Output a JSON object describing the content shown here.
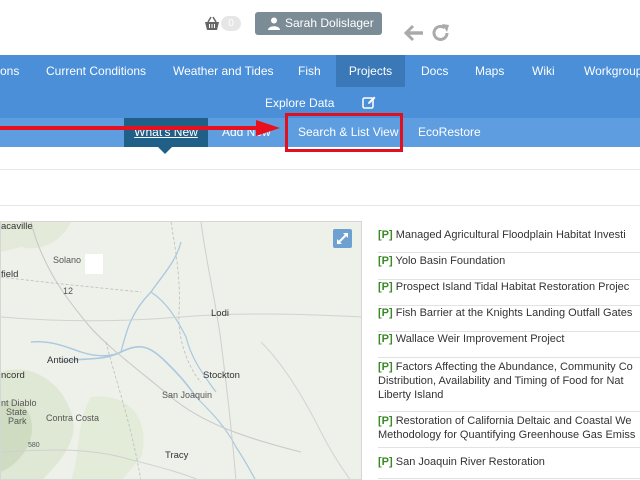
{
  "topbar": {
    "cart_count": "0",
    "user_name": "Sarah Dolislager",
    "icons": [
      "shopping-basket-icon",
      "user-icon",
      "back-arrow-icon",
      "refresh-icon"
    ]
  },
  "mainnav": {
    "items": [
      {
        "label": "ons"
      },
      {
        "label": "Current Conditions"
      },
      {
        "label": "Weather and Tides"
      },
      {
        "label": "Fish"
      },
      {
        "label": "Projects"
      },
      {
        "label": "Docs"
      },
      {
        "label": "Maps"
      },
      {
        "label": "Wiki"
      },
      {
        "label": "Workgroups"
      }
    ],
    "active": "Projects",
    "explore_label": "Explore Data"
  },
  "subnav": {
    "items": [
      {
        "label": "What's New"
      },
      {
        "label": "Add New"
      },
      {
        "label": "Search & List View"
      },
      {
        "label": "EcoRestore"
      }
    ],
    "active": "What's New",
    "highlighted": "Search & List View"
  },
  "map": {
    "labels": {
      "vacaville": "acaville",
      "solano": "Solano",
      "fairfield": "field",
      "lodi": "Lodi",
      "antioch": "Antioch",
      "concord": "ncord",
      "stockton": "Stockton",
      "san_joaquin": "San Joaquin",
      "mt_diablo": "nt Diablo",
      "state": "State",
      "park": "Park",
      "contra_costa": "Contra Costa",
      "tracy": "Tracy",
      "road_12": "12",
      "road_580": "580"
    }
  },
  "projects": {
    "tag": "[P]",
    "items": [
      {
        "lines": [
          "Managed Agricultural Floodplain Habitat Investi"
        ]
      },
      {
        "lines": [
          "Yolo Basin Foundation"
        ]
      },
      {
        "lines": [
          "Prospect Island Tidal Habitat Restoration Projec"
        ]
      },
      {
        "lines": [
          "Fish Barrier at the Knights Landing Outfall Gates"
        ]
      },
      {
        "lines": [
          "Wallace Weir Improvement Project"
        ]
      },
      {
        "lines": [
          "Factors Affecting the Abundance, Community Co",
          "Distribution, Availability and Timing of Food for Nat",
          "Liberty Island"
        ]
      },
      {
        "lines": [
          "Restoration of California Deltaic and Coastal We",
          "Methodology for Quantifying Greenhouse Gas Emiss"
        ]
      },
      {
        "lines": [
          "San Joaquin River Restoration"
        ]
      }
    ]
  },
  "colors": {
    "nav_bg": "#4a8fd8",
    "subnav_bg": "#5e9ee0",
    "active_bg": "#1f5f88",
    "highlight": "#e0101e",
    "tag_green": "#3a8a27"
  }
}
